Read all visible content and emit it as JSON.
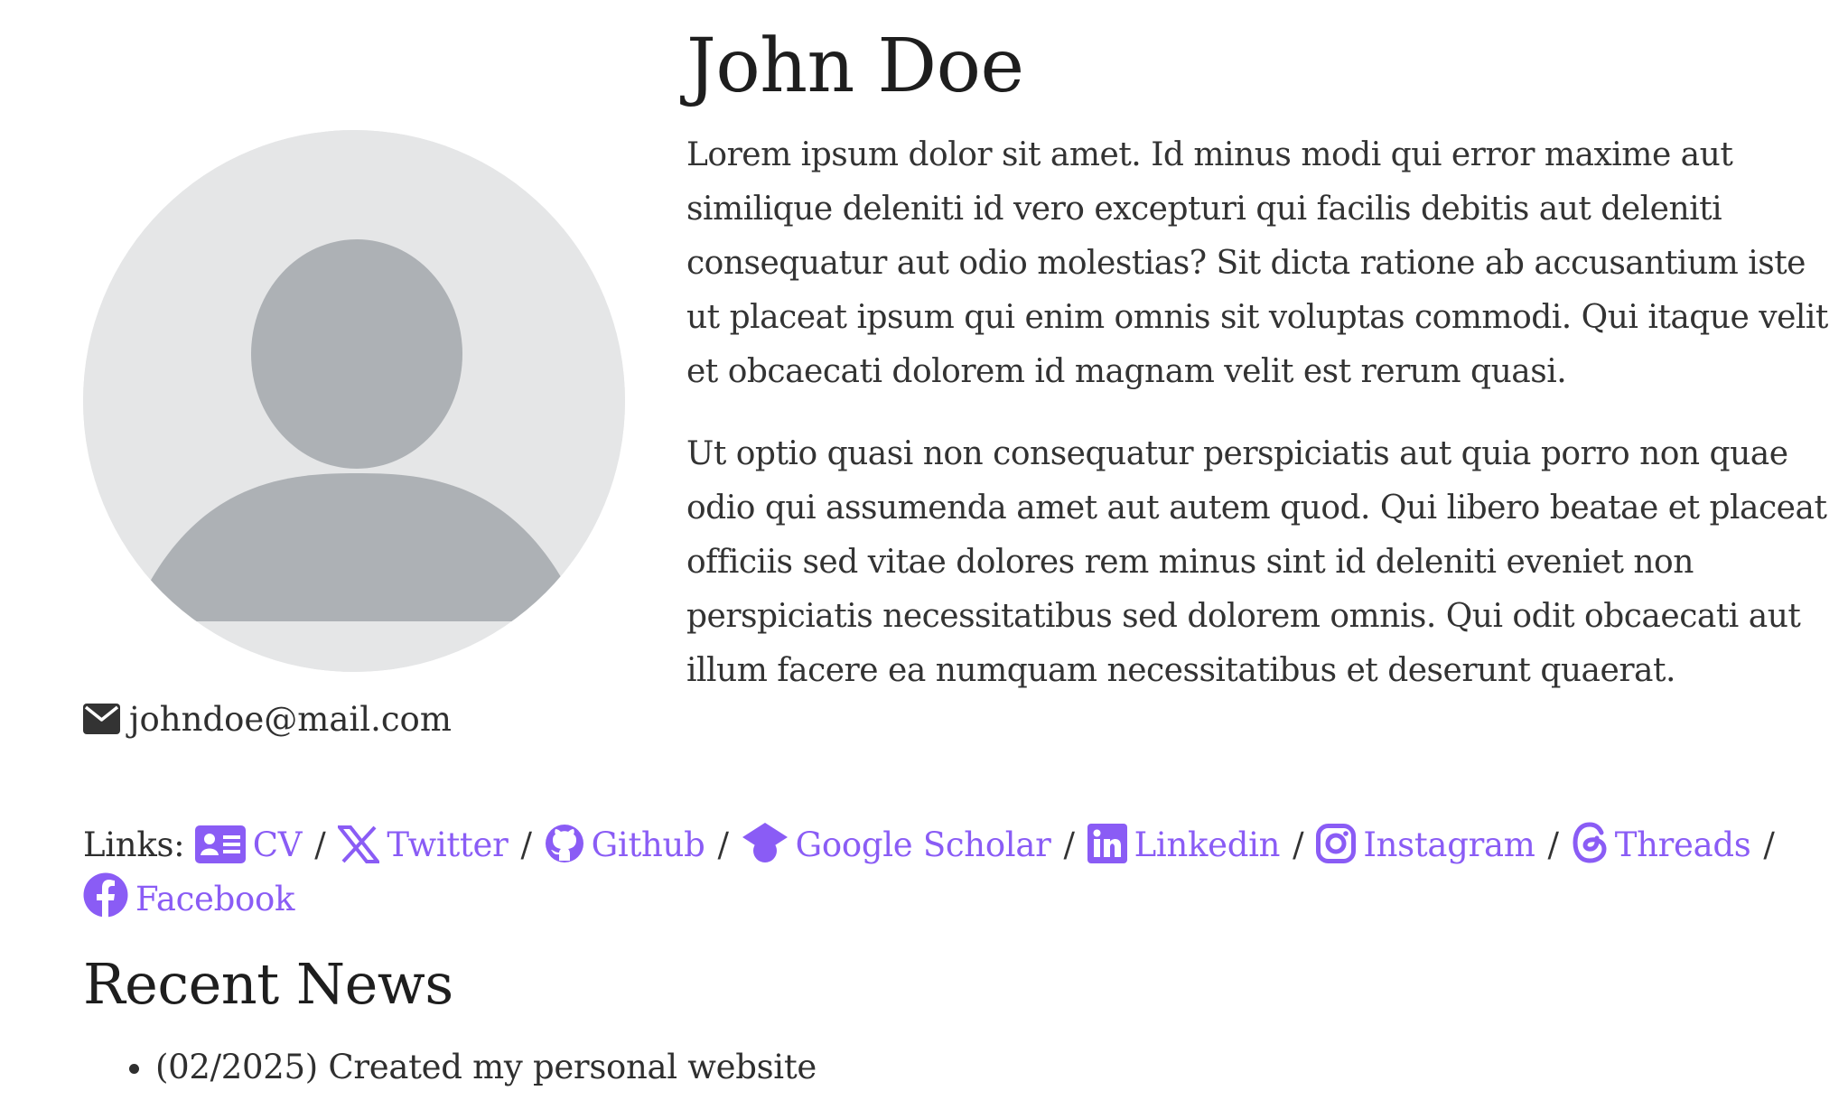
{
  "profile": {
    "name": "John Doe",
    "email": "johndoe@mail.com",
    "avatar_icon": "default-avatar-icon",
    "email_icon": "envelope-icon"
  },
  "bio": {
    "paragraphs": [
      "Lorem ipsum dolor sit amet. Id minus modi qui error maxime aut similique deleniti id vero excepturi qui facilis debitis aut deleniti consequatur aut odio molestias? Sit dicta ratione ab accusantium iste ut placeat ipsum qui enim omnis sit voluptas commodi. Qui itaque velit et obcaecati dolorem id magnam velit est rerum quasi.",
      "Ut optio quasi non consequatur perspiciatis aut quia porro non quae odio qui assumenda amet aut autem quod. Qui libero beatae et placeat officiis sed vitae dolores rem minus sint id deleniti eveniet non perspiciatis necessitatibus sed dolorem omnis. Qui odit obcaecati aut illum facere ea numquam necessitatibus et deserunt quaerat."
    ]
  },
  "links": {
    "label": "Links:",
    "separator": "/",
    "accent_color": "#8a5cf5",
    "items": [
      {
        "label": "CV",
        "icon": "id-card-icon"
      },
      {
        "label": "Twitter",
        "icon": "x-twitter-icon"
      },
      {
        "label": "Github",
        "icon": "github-icon"
      },
      {
        "label": "Google Scholar",
        "icon": "graduation-cap-icon"
      },
      {
        "label": "Linkedin",
        "icon": "linkedin-icon"
      },
      {
        "label": "Instagram",
        "icon": "instagram-icon"
      },
      {
        "label": "Threads",
        "icon": "threads-icon"
      },
      {
        "label": "Facebook",
        "icon": "facebook-icon"
      }
    ]
  },
  "news": {
    "title": "Recent News",
    "items": [
      "(02/2025) Created my personal website"
    ]
  }
}
